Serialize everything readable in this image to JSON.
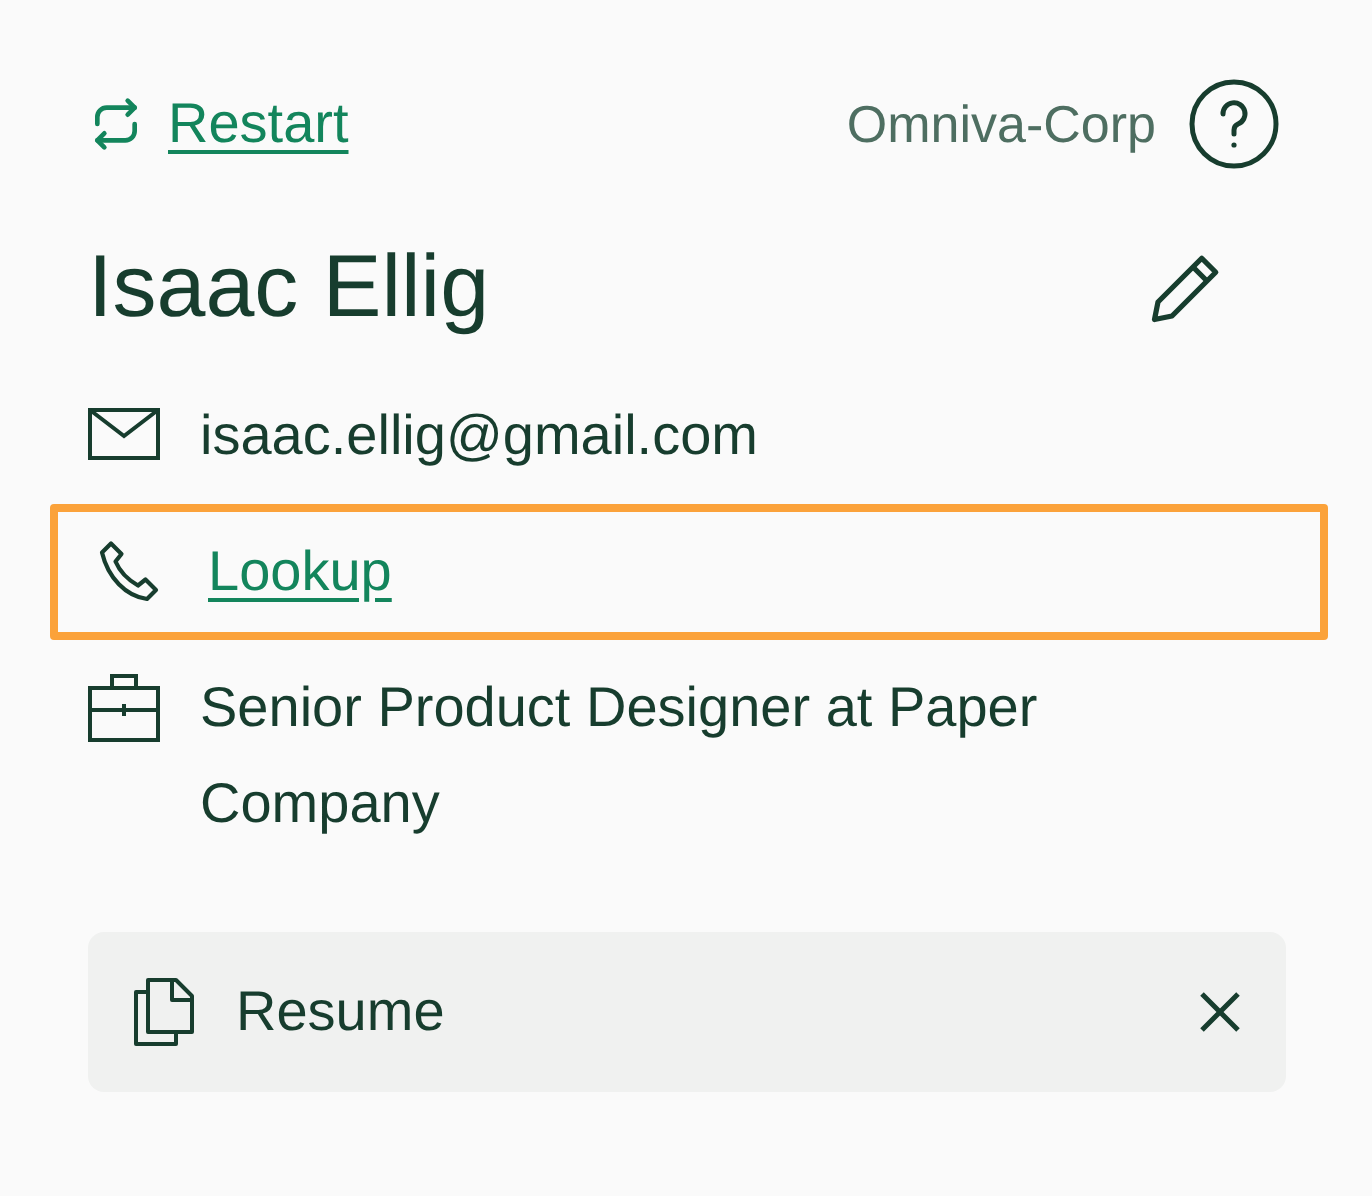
{
  "header": {
    "restart_label": "Restart",
    "organization": "Omniva-Corp"
  },
  "contact": {
    "name": "Isaac Ellig"
  },
  "details": [
    {
      "kind": "email",
      "text": "isaac.ellig@gmail.com",
      "link": false,
      "highlighted": false
    },
    {
      "kind": "phone",
      "text": "Lookup",
      "link": true,
      "highlighted": true
    },
    {
      "kind": "job",
      "text": "Senior Product Designer at Paper Company",
      "link": false,
      "highlighted": false
    }
  ],
  "attachments": [
    {
      "label": "Resume"
    }
  ]
}
